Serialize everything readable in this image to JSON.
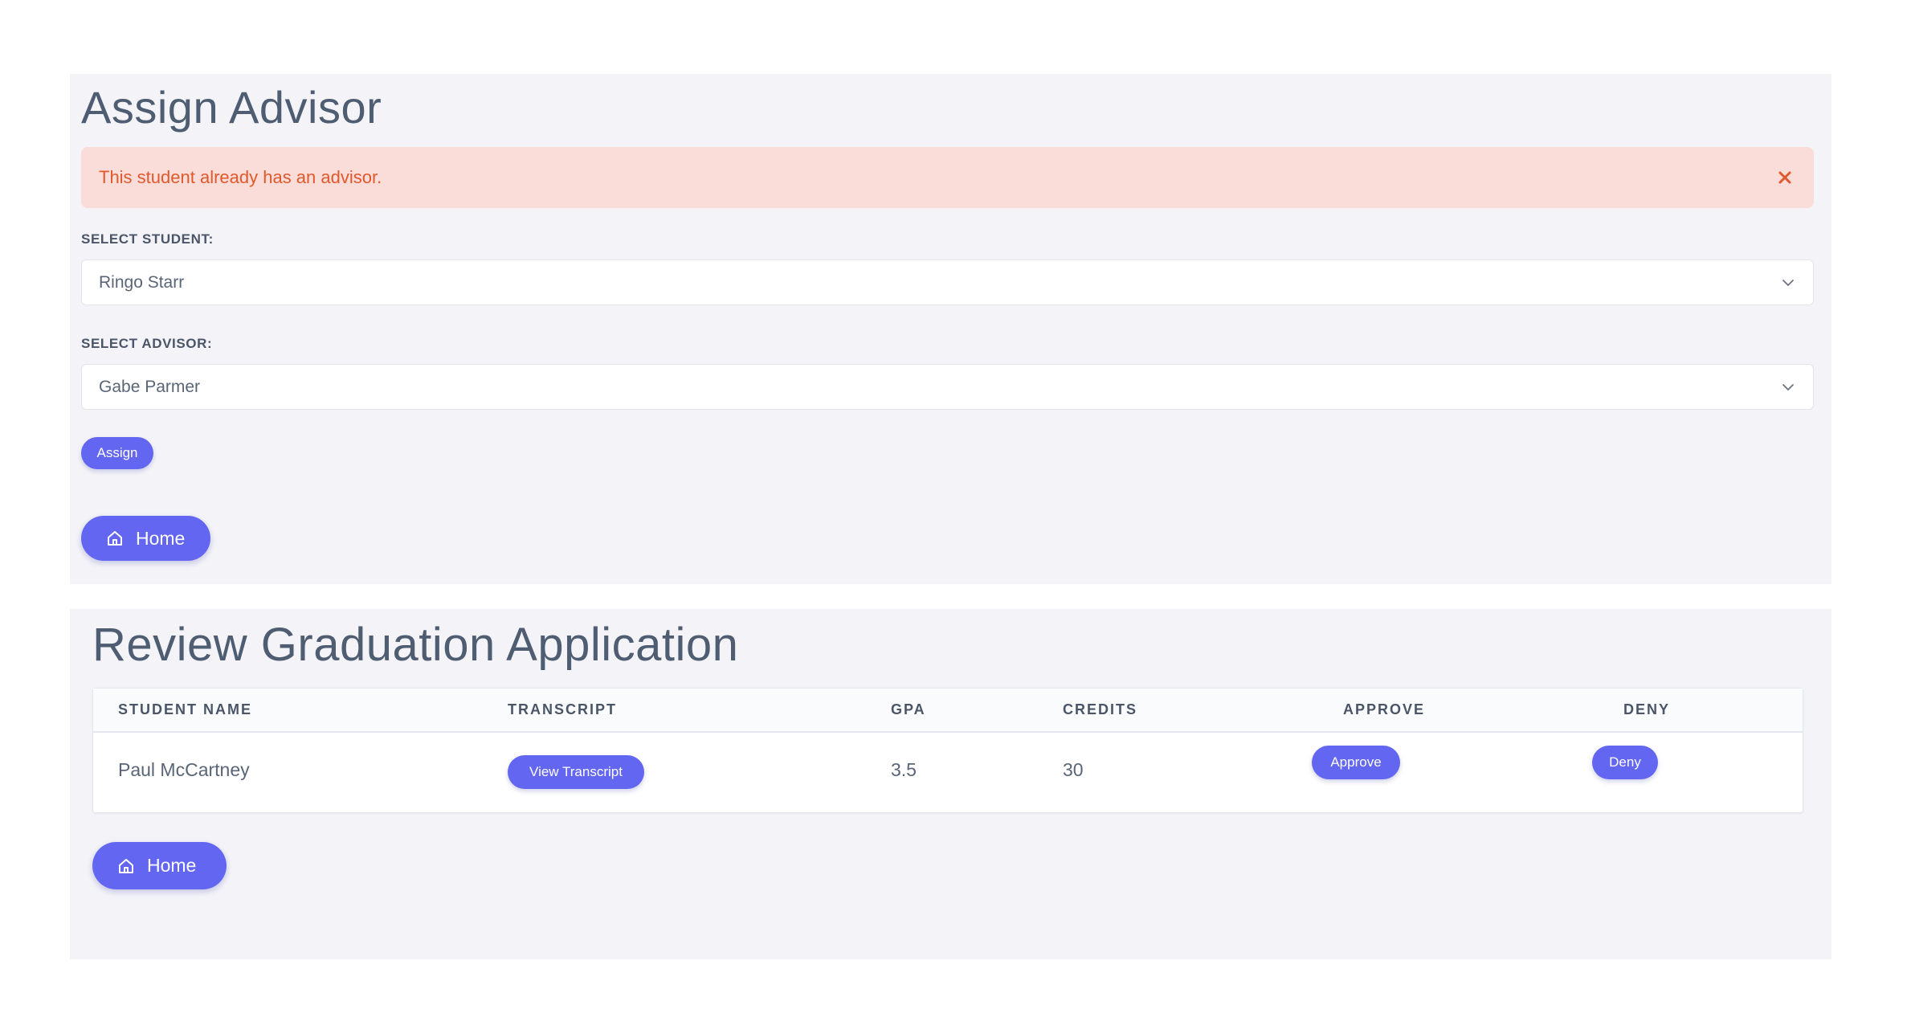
{
  "assign_advisor": {
    "title": "Assign Advisor",
    "alert": {
      "message": "This student already has an advisor.",
      "close_icon": "close-icon",
      "color": "#e0592d",
      "background": "#fadcd8"
    },
    "student_field": {
      "label": "SELECT STUDENT:",
      "selected": "Ringo Starr"
    },
    "advisor_field": {
      "label": "SELECT ADVISOR:",
      "selected": "Gabe Parmer"
    },
    "assign_label": "Assign",
    "home_label": "Home"
  },
  "review_graduation": {
    "title": "Review Graduation Application",
    "columns": [
      "STUDENT NAME",
      "TRANSCRIPT",
      "GPA",
      "CREDITS",
      "APPROVE",
      "DENY"
    ],
    "rows": [
      {
        "student_name": "Paul McCartney",
        "transcript_label": "View Transcript",
        "gpa": "3.5",
        "credits": "30",
        "approve_label": "Approve",
        "deny_label": "Deny"
      }
    ],
    "home_label": "Home"
  },
  "theme": {
    "accent": "#6366f1",
    "panel_background": "#f4f4f8",
    "title_color": "#4f5d73"
  }
}
